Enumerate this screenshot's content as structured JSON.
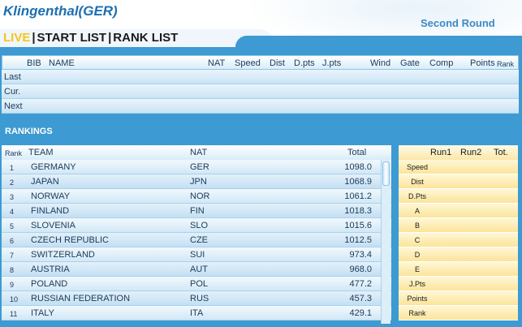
{
  "header": {
    "event_title": "Klingenthal(GER)",
    "round_label": "Second Round"
  },
  "nav": {
    "live": "LIVE",
    "start_list": "START LIST",
    "rank_list": "RANK LIST",
    "separator": "|"
  },
  "live_table": {
    "columns": [
      "BIB",
      "NAME",
      "NAT",
      "Speed",
      "Dist",
      "D.pts",
      "J.pts",
      "Wind",
      "Gate",
      "Comp",
      "Points",
      "Rank"
    ],
    "rows": [
      "Last",
      "Cur.",
      "Next"
    ]
  },
  "rankings": {
    "title": "RANKINGS",
    "columns": {
      "rank": "Rank",
      "team": "TEAM",
      "nat": "NAT",
      "total": "Total"
    },
    "rows": [
      {
        "rank": "1",
        "team": "GERMANY",
        "nat": "GER",
        "total": "1098.0"
      },
      {
        "rank": "2",
        "team": "JAPAN",
        "nat": "JPN",
        "total": "1068.9"
      },
      {
        "rank": "3",
        "team": "NORWAY",
        "nat": "NOR",
        "total": "1061.2"
      },
      {
        "rank": "4",
        "team": "FINLAND",
        "nat": "FIN",
        "total": "1018.3"
      },
      {
        "rank": "5",
        "team": "SLOVENIA",
        "nat": "SLO",
        "total": "1015.6"
      },
      {
        "rank": "6",
        "team": "CZECH REPUBLIC",
        "nat": "CZE",
        "total": "1012.5"
      },
      {
        "rank": "7",
        "team": "SWITZERLAND",
        "nat": "SUI",
        "total": "973.4"
      },
      {
        "rank": "8",
        "team": "AUSTRIA",
        "nat": "AUT",
        "total": "968.0"
      },
      {
        "rank": "9",
        "team": "POLAND",
        "nat": "POL",
        "total": "477.2"
      },
      {
        "rank": "10",
        "team": "RUSSIAN FEDERATION",
        "nat": "RUS",
        "total": "457.3"
      },
      {
        "rank": "11",
        "team": "ITALY",
        "nat": "ITA",
        "total": "429.1"
      }
    ]
  },
  "detail": {
    "columns": [
      "Run1",
      "Run2",
      "Tot."
    ],
    "rows": [
      "Speed",
      "Dist",
      "D.Pts",
      "A",
      "B",
      "C",
      "D",
      "E",
      "J.Pts",
      "Points",
      "Rank"
    ]
  },
  "colors": {
    "accent_blue": "#3d9ad2",
    "title_blue": "#1d6fb1",
    "live_yellow": "#f5c518",
    "detail_yellow": "#fbe49a"
  }
}
